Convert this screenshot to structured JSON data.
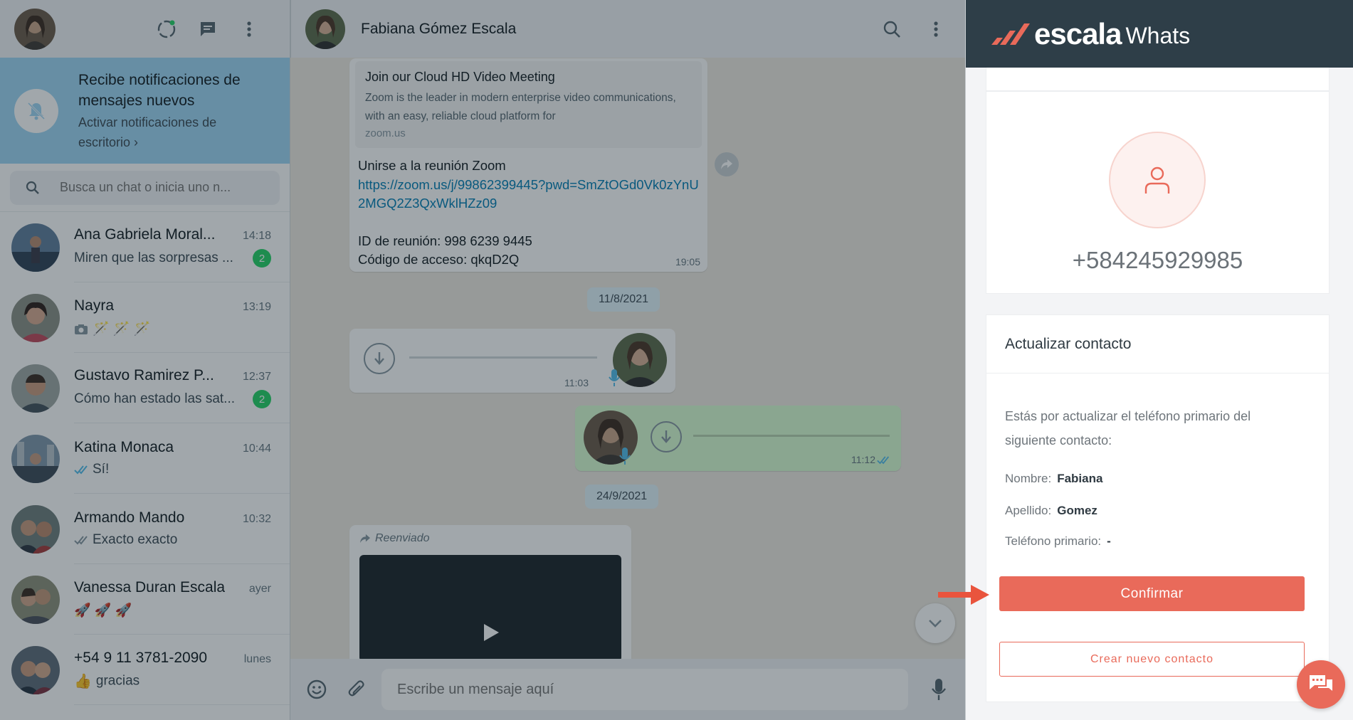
{
  "sidebar": {
    "notification": {
      "title": "Recibe notificaciones de mensajes nuevos",
      "link": "Activar notificaciones de escritorio ›"
    },
    "search_placeholder": "Busca un chat o inicia uno n...",
    "chats": [
      {
        "name": "Ana Gabriela Moral...",
        "time": "14:18",
        "preview": "Miren que las sorpresas ...",
        "unread": "2"
      },
      {
        "name": "Nayra",
        "time": "13:19",
        "preview": "🪄 🪄 🪄",
        "unread": ""
      },
      {
        "name": "Gustavo Ramirez P...",
        "time": "12:37",
        "preview": "Cómo han estado las sat...",
        "unread": "2"
      },
      {
        "name": "Katina Monaca",
        "time": "10:44",
        "preview": "Sí!",
        "unread": ""
      },
      {
        "name": "Armando Mando",
        "time": "10:32",
        "preview": "Exacto exacto",
        "unread": ""
      },
      {
        "name": "Vanessa Duran Escala",
        "time": "ayer",
        "preview": "🚀 🚀 🚀",
        "unread": ""
      },
      {
        "name": "+54 9 11 3781-2090",
        "time": "lunes",
        "preview": "gracias",
        "unread": ""
      }
    ]
  },
  "chat": {
    "contact_name": "Fabiana Gómez Escala",
    "link_preview": {
      "title": "Join our Cloud HD Video Meeting",
      "description": "Zoom is the leader in modern enterprise video communications, with an easy, reliable cloud platform for",
      "domain": "zoom.us"
    },
    "message1": {
      "line1": "Unirse a la reunión Zoom",
      "url": "https://zoom.us/j/99862399445?pwd=SmZtOGd0Vk0zYnU2MGQ2Z3QxWklHZz09",
      "meeting_id": "ID de reunión: 998 6239 9445",
      "access_code": "Código de acceso: qkqD2Q",
      "time": "19:05"
    },
    "date1": "11/8/2021",
    "voice_in_time": "11:03",
    "voice_out_time": "11:12",
    "date2": "24/9/2021",
    "forwarded_label": "Reenviado",
    "composer_placeholder": "Escribe un mensaje aquí"
  },
  "panel": {
    "brand_main": "escala",
    "brand_sub": "Whats",
    "phone": "+584245929985",
    "update_title": "Actualizar contacto",
    "description": "Estás por actualizar el teléfono primario del siguiente contacto:",
    "fields": {
      "nombre_label": "Nombre:",
      "nombre_value": "Fabiana",
      "apellido_label": "Apellido:",
      "apellido_value": "Gomez",
      "telefono_label": "Teléfono primario:",
      "telefono_value": "-"
    },
    "confirm_label": "Confirmar",
    "create_label": "Crear nuevo contacto"
  },
  "colors": {
    "accent": "#e96a5a",
    "panel_header": "#2e3e48",
    "notif_bg": "#9fd6f4",
    "unread_badge": "#25d366",
    "link": "#027eb5"
  }
}
